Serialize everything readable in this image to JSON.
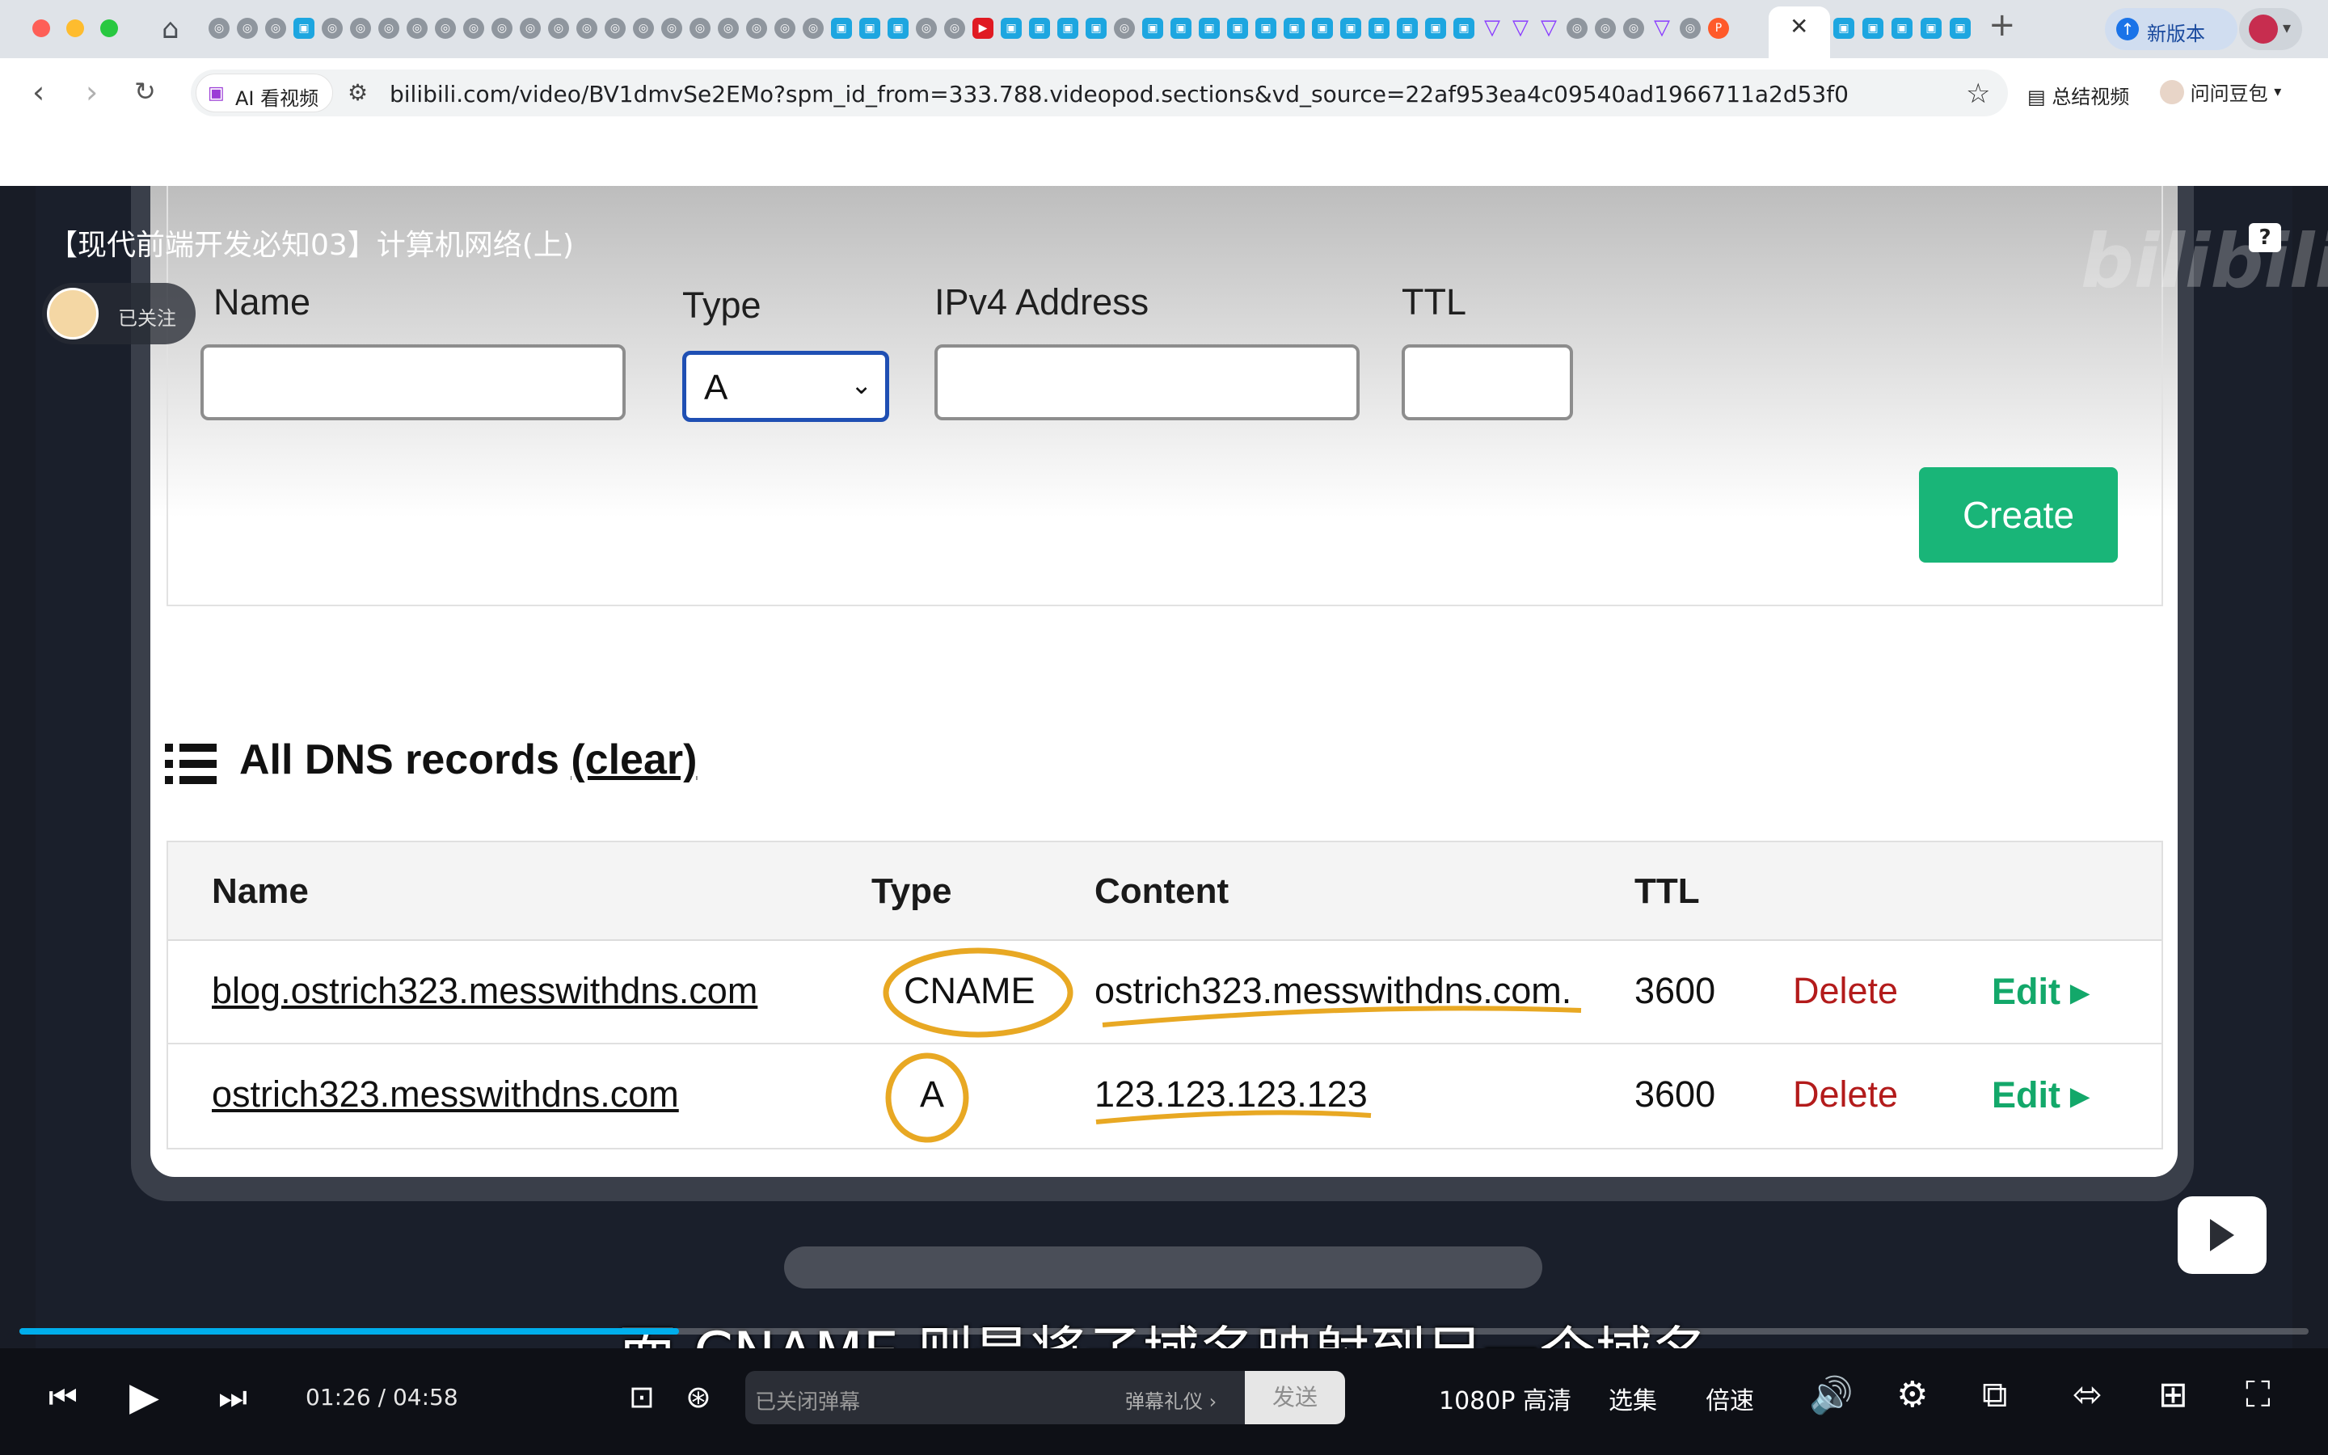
{
  "browser": {
    "active_tab_close": "✕",
    "new_tab": "+",
    "new_version_label": "新版本",
    "ai_pill_label": "AI 看视频",
    "url": "bilibili.com/video/BV1dmvSe2EMo?spm_id_from=333.788.videopod.sections&vd_source=22af953ea4c09540ad1966711a2d53f0",
    "summarize_label": "总结视频",
    "doubao_label": "问问豆包",
    "colors": {
      "tabbar": "#dfe3e8",
      "accent": "#1a73e8"
    }
  },
  "video": {
    "title": "【现代前端开发必知03】计算机网络(上)",
    "follow_label": "已关注",
    "watermark_logo": "bilibili",
    "help_icon": "?",
    "subtitle": "而 CNAME 则是将子域名映射到另一个域名",
    "progress_fraction": 0.288
  },
  "form": {
    "name_label": "Name",
    "type_label": "Type",
    "type_value": "A",
    "ipv4_label": "IPv4 Address",
    "ttl_label": "TTL",
    "create_label": "Create"
  },
  "records": {
    "heading": "All DNS records",
    "clear_label": "(clear)",
    "columns": [
      "Name",
      "Type",
      "Content",
      "TTL"
    ],
    "rows": [
      {
        "name": "blog.ostrich323.messwithdns.com",
        "type": "CNAME",
        "content": "ostrich323.messwithdns.com.",
        "ttl": "3600",
        "delete": "Delete",
        "edit": "Edit"
      },
      {
        "name": "ostrich323.messwithdns.com",
        "type": "A",
        "content": "123.123.123.123",
        "ttl": "3600",
        "delete": "Delete",
        "edit": "Edit"
      }
    ]
  },
  "controls": {
    "current_time": "01:26",
    "separator": "/",
    "duration": "04:58",
    "danmaku_placeholder": "已关闭弹幕",
    "danmaku_etiquette": "弹幕礼仪 ›",
    "send_label": "发送",
    "quality_label": "1080P 高清",
    "episodes_label": "选集",
    "speed_label": "倍速"
  }
}
